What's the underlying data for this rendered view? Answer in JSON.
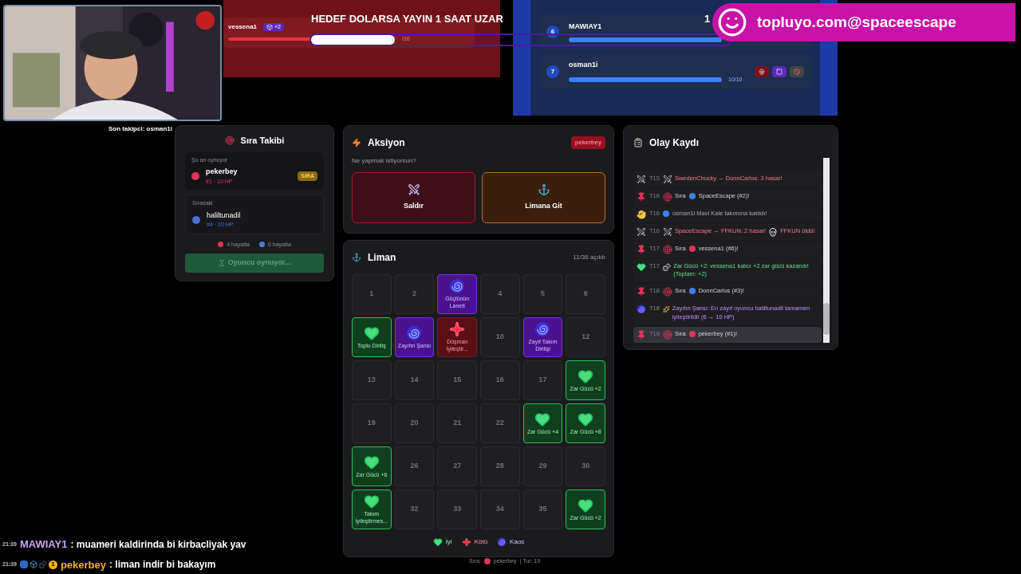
{
  "follower_text": "Son takipci: osman1i",
  "stream_goal": {
    "text": "HEDEF DOLARSA YAYIN 1 SAAT UZAR",
    "level": 0.2,
    "counter": "1"
  },
  "banner": {
    "text": "topluyo.com@spaceescape"
  },
  "red_team": {
    "players": [
      {
        "name": "vessena1",
        "badge": "+2",
        "hp": "/10",
        "level": 1
      }
    ]
  },
  "blue_team": {
    "players": [
      {
        "number": "6",
        "name": "MAWIAY1",
        "level": 1
      },
      {
        "number": "7",
        "name": "osman1i",
        "hp": "10/10",
        "level": 1
      }
    ]
  },
  "turn_tracker": {
    "title": "Sıra Takibi",
    "current": {
      "label": "Şu an oynuyor",
      "name": "pekerbey",
      "stats": "#1 · 10 HP",
      "color": "#e0335a",
      "badge": "SIRA"
    },
    "next": {
      "label": "Sıradaki",
      "name": "haliltunadil",
      "stats": "#4 · 10 HP",
      "color": "#4a6fd0"
    },
    "alive": [
      {
        "text": "4 hayatta",
        "color": "#e0335a"
      },
      {
        "text": "6 hayatta",
        "color": "#4a7fe0"
      }
    ],
    "status_button": {
      "label": "Oyuncu oynuyor...",
      "disabled": true
    }
  },
  "action": {
    "title": "Aksiyon",
    "player_tag": "pekerbey",
    "prompt": "Ne yapmak istiyorsun?",
    "actions": [
      {
        "kind": "attack",
        "label": "Saldır"
      },
      {
        "kind": "port",
        "label": "Limana Git"
      }
    ]
  },
  "port": {
    "title": "Liman",
    "opened": "11/36 açıldı",
    "cells": [
      {
        "kind": "closed",
        "label": "1"
      },
      {
        "kind": "closed",
        "label": "2"
      },
      {
        "kind": "chaos",
        "label": "Güçlünün Laneti"
      },
      {
        "kind": "closed",
        "label": "4"
      },
      {
        "kind": "closed",
        "label": "5"
      },
      {
        "kind": "closed",
        "label": "6"
      },
      {
        "kind": "good",
        "label": "Toplu Diriliş"
      },
      {
        "kind": "chaos",
        "label": "Zayıfın Şansı"
      },
      {
        "kind": "bad",
        "label": "Düşman İyileştir..."
      },
      {
        "kind": "closed",
        "label": "10"
      },
      {
        "kind": "chaos",
        "label": "Zayıf Takım Dirilişi"
      },
      {
        "kind": "closed",
        "label": "12"
      },
      {
        "kind": "closed",
        "label": "13"
      },
      {
        "kind": "closed",
        "label": "14"
      },
      {
        "kind": "closed",
        "label": "15"
      },
      {
        "kind": "closed",
        "label": "16"
      },
      {
        "kind": "closed",
        "label": "17"
      },
      {
        "kind": "good",
        "label": "Zar Gücü +2"
      },
      {
        "kind": "closed",
        "label": "19"
      },
      {
        "kind": "closed",
        "label": "20"
      },
      {
        "kind": "closed",
        "label": "21"
      },
      {
        "kind": "closed",
        "label": "22"
      },
      {
        "kind": "good",
        "label": "Zar Gücü +4"
      },
      {
        "kind": "good",
        "label": "Zar Gücü +8"
      },
      {
        "kind": "good",
        "label": "Zar Gücü +6"
      },
      {
        "kind": "closed",
        "label": "26"
      },
      {
        "kind": "closed",
        "label": "27"
      },
      {
        "kind": "closed",
        "label": "28"
      },
      {
        "kind": "closed",
        "label": "29"
      },
      {
        "kind": "closed",
        "label": "30"
      },
      {
        "kind": "good",
        "label": "Takım İyileştirmes..."
      },
      {
        "kind": "closed",
        "label": "32"
      },
      {
        "kind": "closed",
        "label": "33"
      },
      {
        "kind": "closed",
        "label": "34"
      },
      {
        "kind": "closed",
        "label": "35"
      },
      {
        "kind": "good",
        "label": "Zar Gücü +2"
      }
    ],
    "legend": [
      {
        "kind": "good",
        "label": "İyi"
      },
      {
        "kind": "bad",
        "label": "Kötü"
      },
      {
        "kind": "chaos",
        "label": "Kaos"
      }
    ]
  },
  "log": {
    "title": "Olay Kaydı",
    "entries": [
      {
        "kind": "attack",
        "turn": "T15",
        "text": "SwedenChucky → DonnCarlos: 3 hasar!",
        "selected": false
      },
      {
        "kind": "turn",
        "turn": "T16",
        "prefix": "Sıra",
        "color": "#3b82f6",
        "text": "SpaceEscape (#2)!",
        "selected": false
      },
      {
        "kind": "join",
        "turn": "T16",
        "color": "#3b82f6",
        "text": "osman1i Mavi Kale takımına katıldı!",
        "selected": false
      },
      {
        "kind": "attack",
        "turn": "T16",
        "text": "SpaceEscape → FFKUN: 2 hasar!",
        "death": "FFKUN öldü!",
        "selected": false
      },
      {
        "kind": "turn",
        "turn": "T17",
        "prefix": "Sıra",
        "color": "#e0335a",
        "text": "vessena1 (#6)!",
        "selected": false
      },
      {
        "kind": "good",
        "turn": "T17",
        "text": "Zar Gücü +2: vessena1 kalıcı +2 zar gücü kazandı! (Toplam: +2)",
        "selected": false
      },
      {
        "kind": "turn",
        "turn": "T18",
        "prefix": "Sıra",
        "color": "#3b82f6",
        "text": "DonnCarlos (#3)!",
        "selected": false
      },
      {
        "kind": "chaos",
        "turn": "T18",
        "text": "Zayıfın Şansı: En zayıf oyuncu haliltunadil tamamen iyileştirildi! (6 → 10 HP)",
        "selected": false
      },
      {
        "kind": "turn",
        "turn": "T19",
        "prefix": "Sıra",
        "color": "#e0335a",
        "text": "pekerbey (#1)!",
        "selected": true
      }
    ]
  },
  "footer": {
    "prefix": "Sıra:",
    "color": "#e0335a",
    "name": "pekerbey",
    "turn": "| Tur: 19"
  },
  "chat": [
    {
      "time": "21:39",
      "user": "MAWIAY1",
      "color": "#c6a2f5",
      "message": ": muameri kaldirinda bi kirbacliyak yav"
    },
    {
      "time": "21:39",
      "badge": "1",
      "user": "pekerbey",
      "color": "#f5b21a",
      "message": ": liman indir bi bakayım"
    }
  ]
}
